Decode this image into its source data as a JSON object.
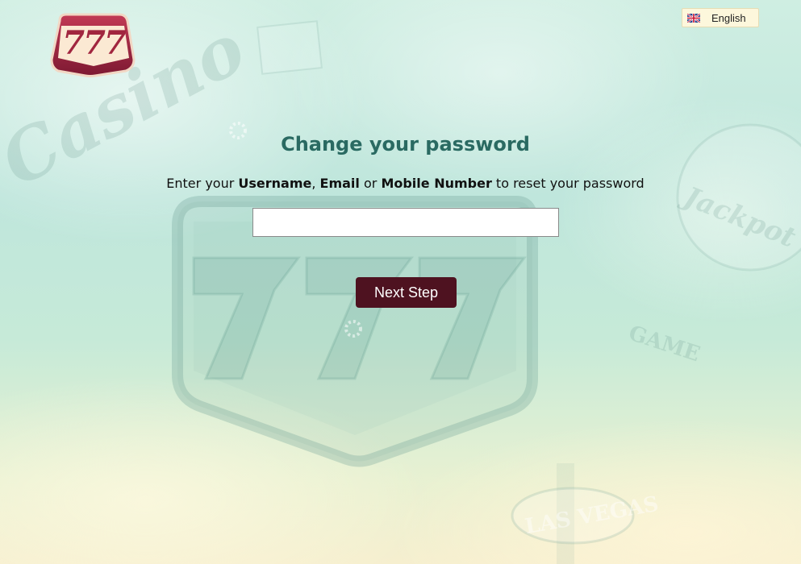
{
  "brand": {
    "logo_text": "777"
  },
  "language": {
    "label": "English",
    "flag_icon": "uk-flag-icon"
  },
  "form": {
    "title": "Change your password",
    "instruction_prefix": "Enter your ",
    "username_word": "Username",
    "separator": ", ",
    "email_word": "Email",
    "or_word": " or ",
    "mobile_word": "Mobile Number",
    "instruction_suffix": " to reset your password",
    "input_value": "",
    "input_placeholder": "",
    "submit_label": "Next Step"
  },
  "background": {
    "words": [
      "Casino",
      "Jackpot",
      "GAME",
      "LAS VEGAS"
    ],
    "emblem_text": "777"
  },
  "colors": {
    "title": "#2a6a62",
    "button": "#4e1220",
    "lang_bg": "#fdf7dc"
  }
}
